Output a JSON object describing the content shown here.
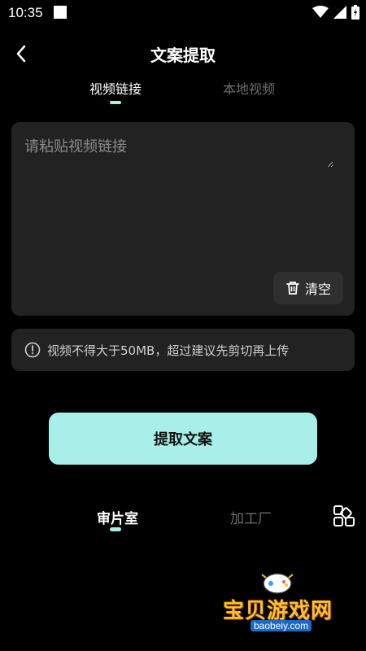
{
  "status_bar": {
    "time": "10:35"
  },
  "header": {
    "title": "文案提取"
  },
  "tabs": [
    {
      "label": "视频链接",
      "active": true
    },
    {
      "label": "本地视频",
      "active": false
    }
  ],
  "link_input": {
    "placeholder": "请粘贴视频链接",
    "value": ""
  },
  "clear_button": {
    "label": "清空"
  },
  "notice": {
    "text": "视频不得大于50MB，超过建议先剪切再上传"
  },
  "extract_button": {
    "label": "提取文案"
  },
  "bottom_tabs": [
    {
      "label": "审片室",
      "active": true
    },
    {
      "label": "加工厂",
      "active": false
    }
  ],
  "watermark": {
    "title": "宝贝游戏网",
    "url": "baobeiy.com"
  },
  "colors": {
    "accent": "#a7efe8",
    "background": "#000000",
    "card": "#222222",
    "muted_text": "#6d6d6d"
  }
}
